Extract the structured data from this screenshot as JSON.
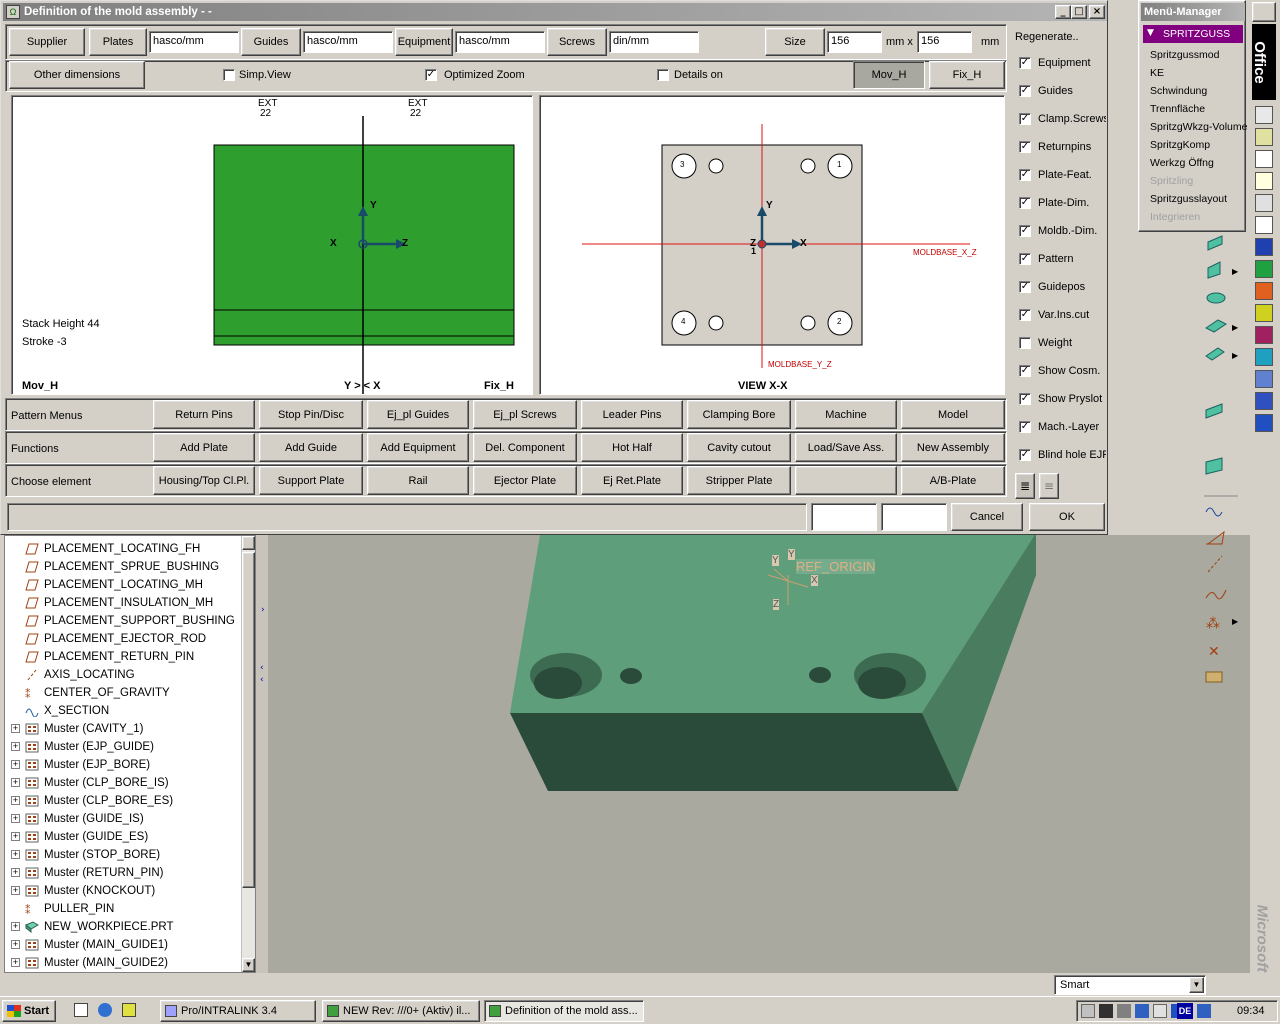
{
  "dialog": {
    "title": "Definition of the mold assembly - -",
    "toolbar": {
      "supplier_label": "Supplier",
      "plates_label": "Plates",
      "plates_value": "hasco/mm",
      "guides_label": "Guides",
      "guides_value": "hasco/mm",
      "equipment_label": "Equipment",
      "equipment_value": "hasco/mm",
      "screws_label": "Screws",
      "screws_value": "din/mm",
      "size_label": "Size",
      "size_w": "156",
      "size_sep": "mm x",
      "size_h": "156",
      "size_unit": "mm"
    },
    "options": {
      "other_dimensions": "Other dimensions",
      "simp_view": "Simp.View",
      "optimized_zoom": "Optimized Zoom",
      "details_on": "Details on",
      "mov_h": "Mov_H",
      "fix_h": "Fix_H"
    },
    "left_view": {
      "ext_left": "EXT",
      "ext_left_num": "22",
      "ext_right": "EXT",
      "ext_right_num": "22",
      "axis_y": "Y",
      "axis_x": "X",
      "axis_z": "Z",
      "stack_height": "Stack Height 44",
      "stroke": "Stroke -3",
      "footer_left": "Mov_H",
      "footer_mid": "Y > < X",
      "footer_right": "Fix_H"
    },
    "right_view": {
      "hole_labels": [
        "3",
        "1",
        "4",
        "2"
      ],
      "axis_y": "Y",
      "axis_x": "X",
      "axis_z": "Z",
      "origin_num": "1",
      "moldbase_xz": "MOLDBASE_X_Z",
      "moldbase_yz": "MOLDBASE_Y_Z",
      "footer": "VIEW X-X"
    },
    "rows": [
      {
        "label": "Pattern Menus",
        "buttons": [
          "Return Pins",
          "Stop Pin/Disc",
          "Ej_pl Guides",
          "Ej_pl Screws",
          "Leader Pins",
          "Clamping Bore",
          "Machine",
          "Model"
        ]
      },
      {
        "label": "Functions",
        "buttons": [
          "Add Plate",
          "Add Guide",
          "Add Equipment",
          "Del. Component",
          "Hot Half",
          "Cavity cutout",
          "Load/Save Ass.",
          "New Assembly"
        ]
      },
      {
        "label": "Choose element",
        "buttons": [
          "Housing/Top Cl.Pl.",
          "Support Plate",
          "Rail",
          "Ejector Plate",
          "Ej Ret.Plate",
          "Stripper Plate",
          "",
          "A/B-Plate"
        ]
      }
    ],
    "cancel": "Cancel",
    "ok": "OK",
    "regenerate": "Regenerate..",
    "checks": [
      {
        "label": "Equipment",
        "checked": true
      },
      {
        "label": "Guides",
        "checked": true
      },
      {
        "label": "Clamp.Screws",
        "checked": true
      },
      {
        "label": "Returnpins",
        "checked": true
      },
      {
        "label": "Plate-Feat.",
        "checked": true
      },
      {
        "label": "Plate-Dim.",
        "checked": true
      },
      {
        "label": "Moldb.-Dim.",
        "checked": true
      },
      {
        "label": "Pattern",
        "checked": true
      },
      {
        "label": "Guidepos",
        "checked": true
      },
      {
        "label": "Var.Ins.cut",
        "checked": true
      },
      {
        "label": "Weight",
        "checked": false
      },
      {
        "label": "Show Cosm.",
        "checked": true
      },
      {
        "label": "Show Pryslot",
        "checked": true
      },
      {
        "label": "Mach.-Layer",
        "checked": true
      },
      {
        "label": "Blind hole EJP",
        "checked": true
      }
    ],
    "check_mark": "✓"
  },
  "menu_manager": {
    "title": "Menü-Manager",
    "header": "SPRITZGUSS",
    "items": [
      {
        "label": "Spritzgussmod",
        "enabled": true
      },
      {
        "label": "KE",
        "enabled": true
      },
      {
        "label": "Schwindung",
        "enabled": true
      },
      {
        "label": "Trennfläche",
        "enabled": true
      },
      {
        "label": "SpritzgWkzg-Volume",
        "enabled": true
      },
      {
        "label": "SpritzgKomp",
        "enabled": true
      },
      {
        "label": "Werkzg Öffng",
        "enabled": true
      },
      {
        "label": "Spritzling",
        "enabled": false
      },
      {
        "label": "Spritzgusslayout",
        "enabled": true
      },
      {
        "label": "Integrieren",
        "enabled": false
      }
    ]
  },
  "tree": {
    "items": [
      {
        "label": "PLACEMENT_LOCATING_FH",
        "icon": "plane",
        "expandable": false
      },
      {
        "label": "PLACEMENT_SPRUE_BUSHING",
        "icon": "plane",
        "expandable": false
      },
      {
        "label": "PLACEMENT_LOCATING_MH",
        "icon": "plane",
        "expandable": false
      },
      {
        "label": "PLACEMENT_INSULATION_MH",
        "icon": "plane",
        "expandable": false
      },
      {
        "label": "PLACEMENT_SUPPORT_BUSHING",
        "icon": "plane",
        "expandable": false
      },
      {
        "label": "PLACEMENT_EJECTOR_ROD",
        "icon": "plane",
        "expandable": false
      },
      {
        "label": "PLACEMENT_RETURN_PIN",
        "icon": "plane",
        "expandable": false
      },
      {
        "label": "AXIS_LOCATING",
        "icon": "axis",
        "expandable": false
      },
      {
        "label": "CENTER_OF_GRAVITY",
        "icon": "point",
        "expandable": false
      },
      {
        "label": "X_SECTION",
        "icon": "section",
        "expandable": false
      },
      {
        "label": "Muster (CAVITY_1)",
        "icon": "pattern",
        "expandable": true
      },
      {
        "label": "Muster (EJP_GUIDE)",
        "icon": "pattern",
        "expandable": true
      },
      {
        "label": "Muster (EJP_BORE)",
        "icon": "pattern",
        "expandable": true
      },
      {
        "label": "Muster (CLP_BORE_IS)",
        "icon": "pattern",
        "expandable": true
      },
      {
        "label": "Muster (CLP_BORE_ES)",
        "icon": "pattern",
        "expandable": true
      },
      {
        "label": "Muster (GUIDE_IS)",
        "icon": "pattern",
        "expandable": true
      },
      {
        "label": "Muster (GUIDE_ES)",
        "icon": "pattern",
        "expandable": true
      },
      {
        "label": "Muster (STOP_BORE)",
        "icon": "pattern",
        "expandable": true
      },
      {
        "label": "Muster (RETURN_PIN)",
        "icon": "pattern",
        "expandable": true
      },
      {
        "label": "Muster (KNOCKOUT)",
        "icon": "pattern",
        "expandable": true
      },
      {
        "label": "PULLER_PIN",
        "icon": "point",
        "expandable": false
      },
      {
        "label": "NEW_WORKPIECE.PRT",
        "icon": "part",
        "expandable": true
      },
      {
        "label": "Muster (MAIN_GUIDE1)",
        "icon": "pattern",
        "expandable": true
      },
      {
        "label": "Muster (MAIN_GUIDE2)",
        "icon": "pattern",
        "expandable": true
      }
    ]
  },
  "viewport": {
    "ref_origin": "REF_ORIGIN",
    "csys_y1": "Y",
    "csys_y2": "Y",
    "csys_x": "X",
    "csys_z": "Z"
  },
  "filter_select": "Smart",
  "office": {
    "label": "Office",
    "microsoft": "Microsoft"
  },
  "taskbar": {
    "start": "Start",
    "tasks": [
      "Pro/INTRALINK 3.4",
      "NEW Rev: ///0+ (Aktiv) il...",
      "Definition of the mold ass..."
    ],
    "clock": "09:34",
    "lang": "DE"
  },
  "colors": {
    "plate_green": "#2e9e2e",
    "part_face": "#5f9e7a",
    "part_front": "#2a4a3a",
    "menu_highlight": "#800080"
  }
}
